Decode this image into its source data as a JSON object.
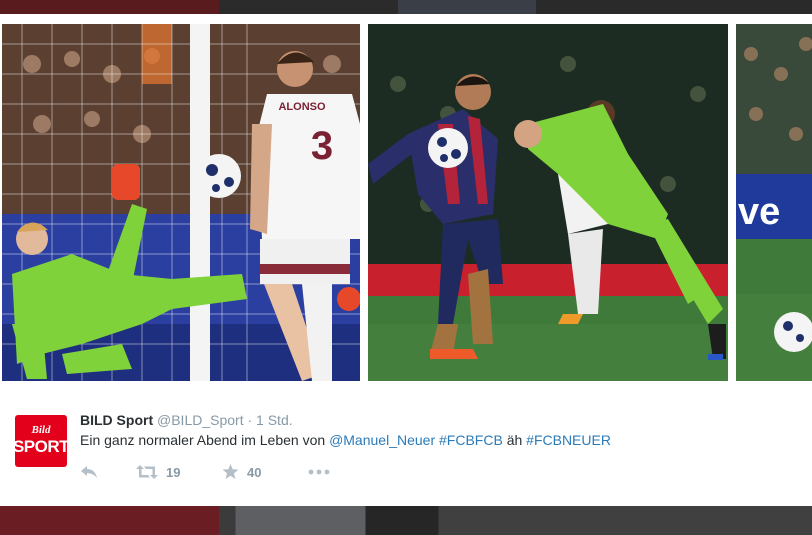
{
  "tweet": {
    "author_name": "BILD Sport",
    "author_handle": "@BILD_Sport",
    "separator": "·",
    "time": "1 Std.",
    "text_lead": "Ein ganz normaler Abend im Leben von",
    "mention": "@Manuel_Neuer",
    "hashtag_1": "#FCBFCB",
    "text_mid": "äh",
    "hashtag_2": "#FCBNEUER",
    "retweet_count": "19",
    "favorite_count": "40"
  },
  "avatar": {
    "line_1": "Bild",
    "line_2": "SPORT"
  },
  "photos": {
    "photo_1_jersey_name": "ALONSO",
    "photo_1_jersey_number": "3",
    "photo_3_board_text": "ve"
  },
  "icons": [
    "reply-icon",
    "retweet-icon",
    "favorite-icon",
    "more-icon"
  ],
  "colors": {
    "link": "#2b7bb9",
    "muted": "#8899a6",
    "text": "#292f33",
    "avatar_red": "#e2001a",
    "keeper_green": "#7fd23a"
  }
}
